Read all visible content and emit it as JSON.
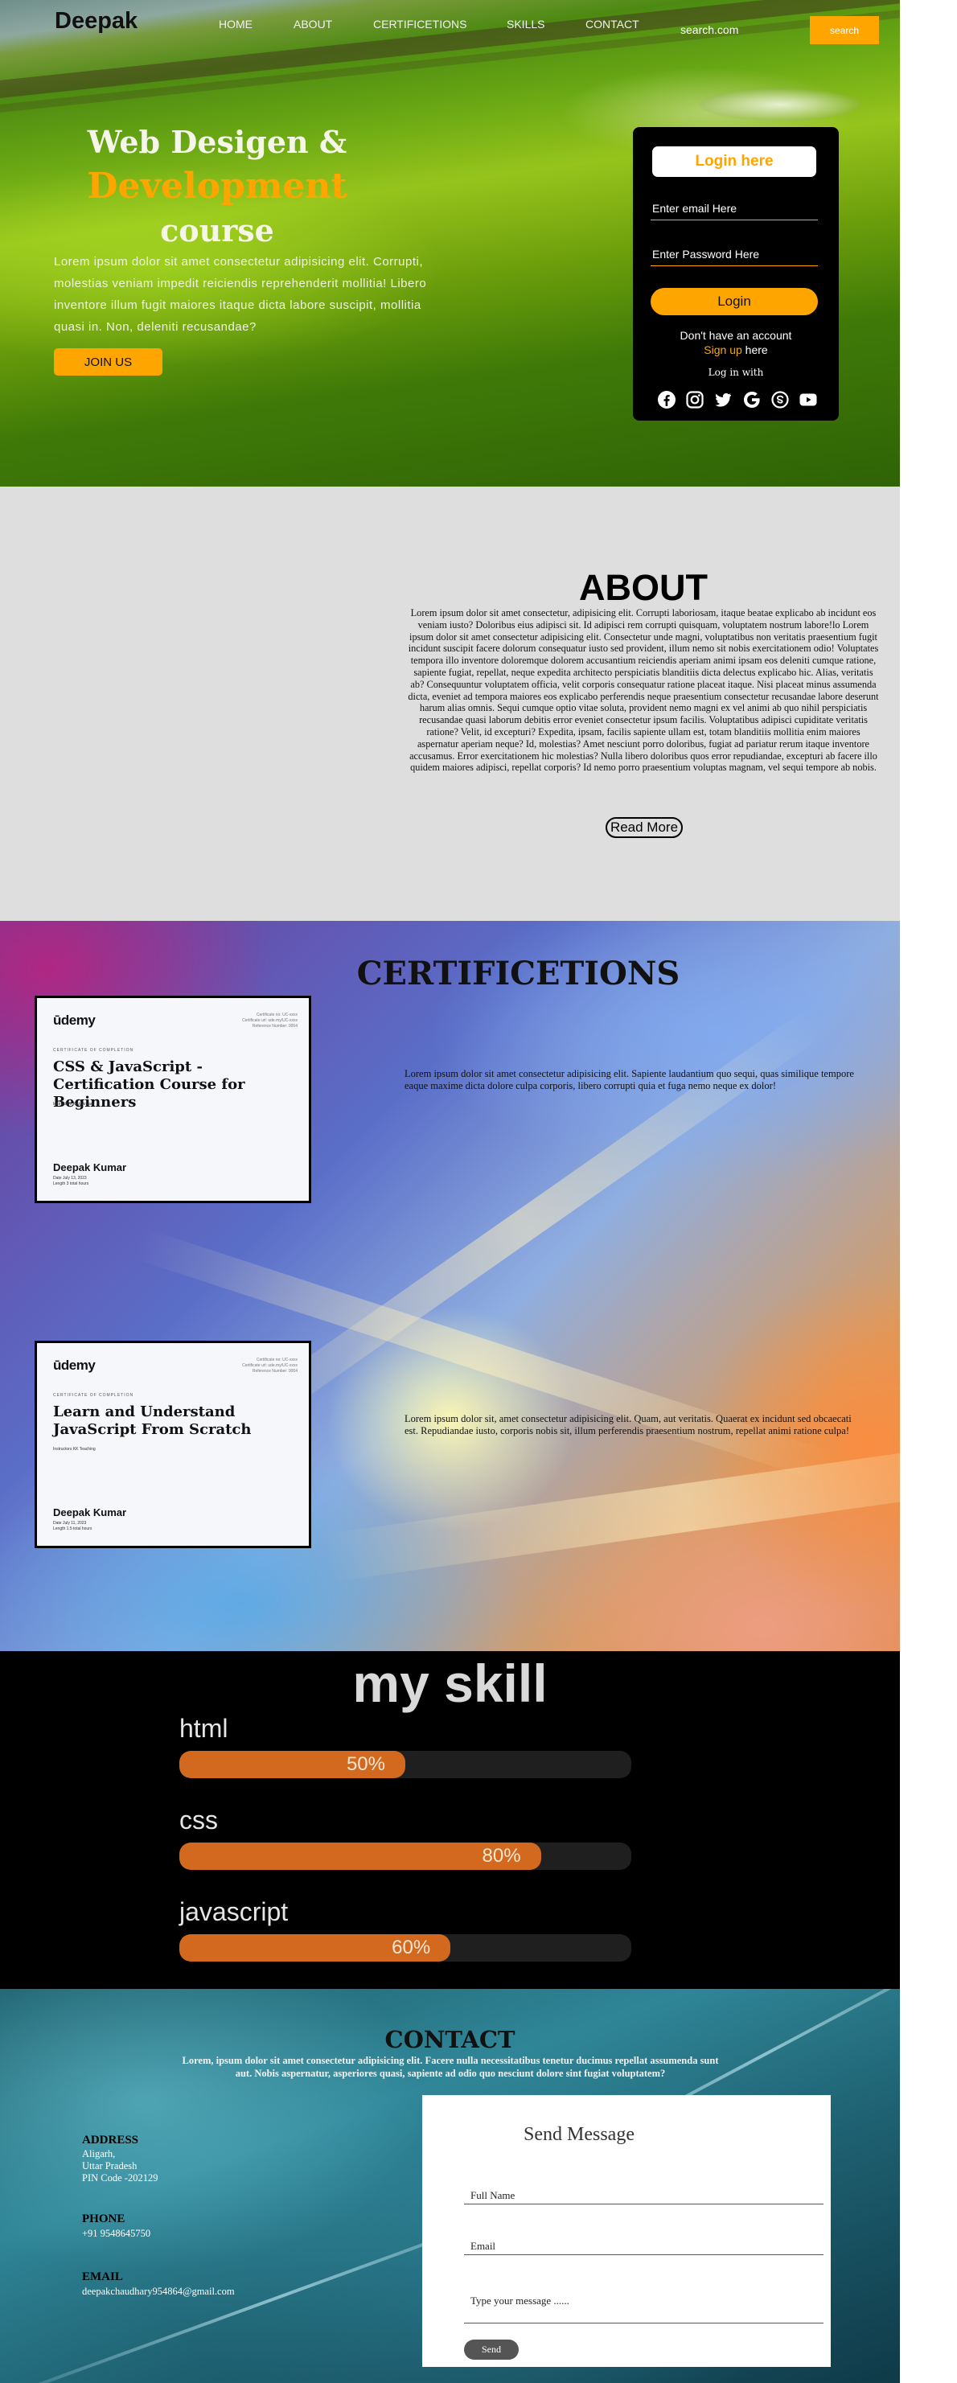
{
  "nav": {
    "logo": "Deepak",
    "links": [
      "HOME",
      "ABOUT",
      "CERTIFICETIONS",
      "SKILLS",
      "CONTACT"
    ],
    "search_placeholder": "search.com",
    "search_button": "search"
  },
  "hero": {
    "title_line1": "Web Desigen &",
    "title_line2": "Development",
    "title_line3": "course",
    "text": "Lorem ipsum dolor sit amet consectetur adipisicing elit. Corrupti, molestias veniam impedit reiciendis reprehenderit mollitia! Libero inventore illum fugit maiores itaque dicta labore suscipit, mollitia quasi in. Non, deleniti recusandae?",
    "join_button": "JOIN US"
  },
  "login": {
    "title": "Login here",
    "email_placeholder": "Enter email Here",
    "password_placeholder": "Enter Password Here",
    "login_button": "Login",
    "no_account": "Don't have an account",
    "signup_link": "Sign up",
    "signup_suffix": "here",
    "log_in_with": "Log in with",
    "social_icons": [
      "facebook-icon",
      "instagram-icon",
      "twitter-icon",
      "google-icon",
      "skype-icon",
      "youtube-icon"
    ]
  },
  "about": {
    "title": "ABOUT",
    "text": "Lorem ipsum dolor sit amet consectetur, adipisicing elit. Corrupti laboriosam, itaque beatae explicabo ab incidunt eos veniam iusto? Doloribus eius adipisci sit. Id adipisci rem corrupti quisquam, voluptatem nostrum labore!lo Lorem ipsum dolor sit amet consectetur adipisicing elit. Consectetur unde magni, voluptatibus non veritatis praesentium fugit incidunt suscipit facere dolorum consequatur iusto sed provident, illum nemo sit nobis exercitationem odio! Voluptates tempora illo inventore doloremque dolorem accusantium reiciendis aperiam animi ipsam eos deleniti cumque ratione, sapiente fugiat, repellat, neque expedita architecto perspiciatis blanditiis dicta delectus explicabo hic. Alias, veritatis ab? Consequuntur voluptatem officia, velit corporis consequatur ratione placeat itaque. Nisi placeat minus assumenda dicta, eveniet ad tempora maiores eos explicabo perferendis neque praesentium consectetur recusandae labore deserunt harum alias omnis. Sequi cumque optio vitae soluta, provident nemo magni ex vel animi ab quo nihil perspiciatis recusandae quasi laborum debitis error eveniet consectetur ipsum facilis. Voluptatibus adipisci cupiditate veritatis ratione? Velit, id excepturi? Expedita, ipsam, facilis sapiente ullam est, totam blanditiis mollitia enim maiores aspernatur aperiam neque? Id, molestias? Amet nesciunt porro doloribus, fugiat ad pariatur rerum itaque inventore accusamus. Error exercitationem hic molestias? Nulla libero doloribus quos error repudiandae, excepturi ab facere illo quidem maiores adipisci, repellat corporis? Id nemo porro praesentium voluptas magnam, vel sequi tempore ab nobis.",
    "read_more": "Read More"
  },
  "certifications": {
    "title": "CERTIFICETIONS",
    "items": [
      {
        "brand": "ūdemy",
        "caption": "CERTIFICATE OF COMPLETION",
        "course": "CSS & JavaScript - Certification Course for Beginners",
        "instructors": "Instructors  Kazi Ariyan",
        "name": "Deepak Kumar",
        "date": "Date  July 13, 2023",
        "length": "Length  3 total hours",
        "desc": "Lorem ipsum dolor sit amet consectetur adipisicing elit. Sapiente laudantium quo sequi, quas similique tempore eaque maxime dicta dolore culpa corporis, libero corrupti quia et fuga nemo neque ex dolor!"
      },
      {
        "brand": "ūdemy",
        "caption": "CERTIFICATE OF COMPLETION",
        "course": "Learn and Understand JavaScript From Scratch",
        "instructors": "Instructors  KK Teaching",
        "name": "Deepak Kumar",
        "date": "Date  July 11, 2023",
        "length": "Length  1.5 total hours",
        "desc": "Lorem ipsum dolor sit, amet consectetur adipisicing elit. Quam, aut veritatis. Quaerat ex incidunt sed obcaecati est. Repudiandae iusto, corporis nobis sit, illum perferendis praesentium nostrum, repellat animi ratione culpa!"
      }
    ]
  },
  "skills": {
    "title": "my skill",
    "items": [
      {
        "name": "html",
        "percent": 50,
        "percent_label": "50%"
      },
      {
        "name": "css",
        "percent": 80,
        "percent_label": "80%"
      },
      {
        "name": "javascript",
        "percent": 60,
        "percent_label": "60%"
      }
    ],
    "bar_color": "#d2691e"
  },
  "contact": {
    "title": "CONTACT",
    "subtitle": "Lorem, ipsum dolor sit amet consectetur adipisicing elit. Facere nulla necessitatibus tenetur ducimus repellat assumenda sunt aut. Nobis aspernatur, asperiores quasi, sapiente ad odio quo nesciunt dolore sint fugiat voluptatem?",
    "address_head": "ADDRESS",
    "address_lines": [
      "Aligarh,",
      "Uttar Pradesh",
      "PIN Code -202129"
    ],
    "phone_head": "PHONE",
    "phone": "+91 9548645750",
    "email_head": "EMAIL",
    "email": "deepakchaudhary954864@gmail.com",
    "form": {
      "title": "Send Message",
      "name_placeholder": "Full Name",
      "email_placeholder": "Email",
      "message_placeholder": "Type your message ......",
      "send_button": "Send"
    }
  },
  "colors": {
    "accent": "#ffa500",
    "about_bg": "#dedede",
    "skills_bg": "#000000"
  }
}
